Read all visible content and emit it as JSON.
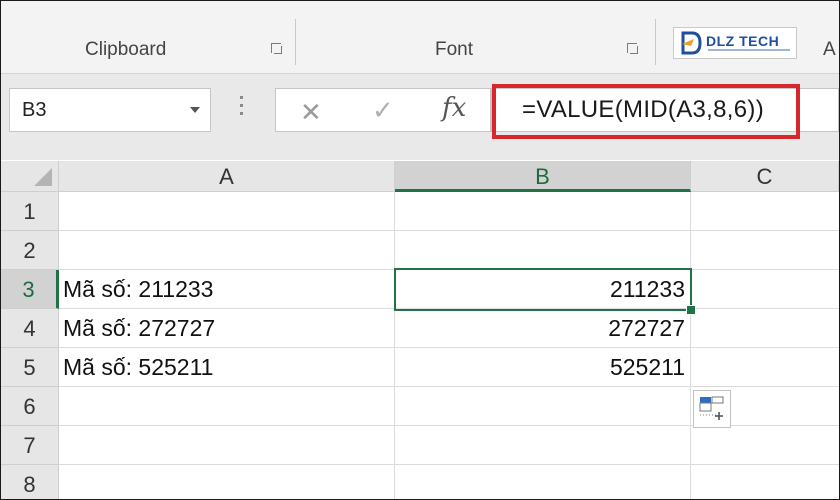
{
  "ribbon": {
    "groups": [
      {
        "label": "Clipboard"
      },
      {
        "label": "Font"
      }
    ],
    "logo_text": "DLZ TECH",
    "partial_label": "A"
  },
  "formula_bar": {
    "name_box": "B3",
    "cancel_symbol": "✕",
    "enter_symbol": "✓",
    "fx_symbol": "fx",
    "formula": "=VALUE(MID(A3,8,6))",
    "highlight_color": "#d9262b"
  },
  "grid": {
    "columns": [
      "A",
      "B",
      "C"
    ],
    "rows": [
      "1",
      "2",
      "3",
      "4",
      "5",
      "6",
      "7",
      "8"
    ],
    "selected_column": "B",
    "selected_row": "3",
    "active_cell": "B3",
    "cells": {
      "A3": "Mã số: 211233",
      "A4": "Mã số: 272727",
      "A5": "Mã số: 525211",
      "B3": "211233",
      "B4": "272727",
      "B5": "525211"
    }
  },
  "colors": {
    "excel_green": "#217346",
    "header_bg": "#e6e6e6"
  },
  "icons": [
    "dialog-launcher-icon",
    "dropdown-arrow-icon",
    "cancel-icon",
    "enter-icon",
    "function-icon",
    "paste-options-icon"
  ]
}
